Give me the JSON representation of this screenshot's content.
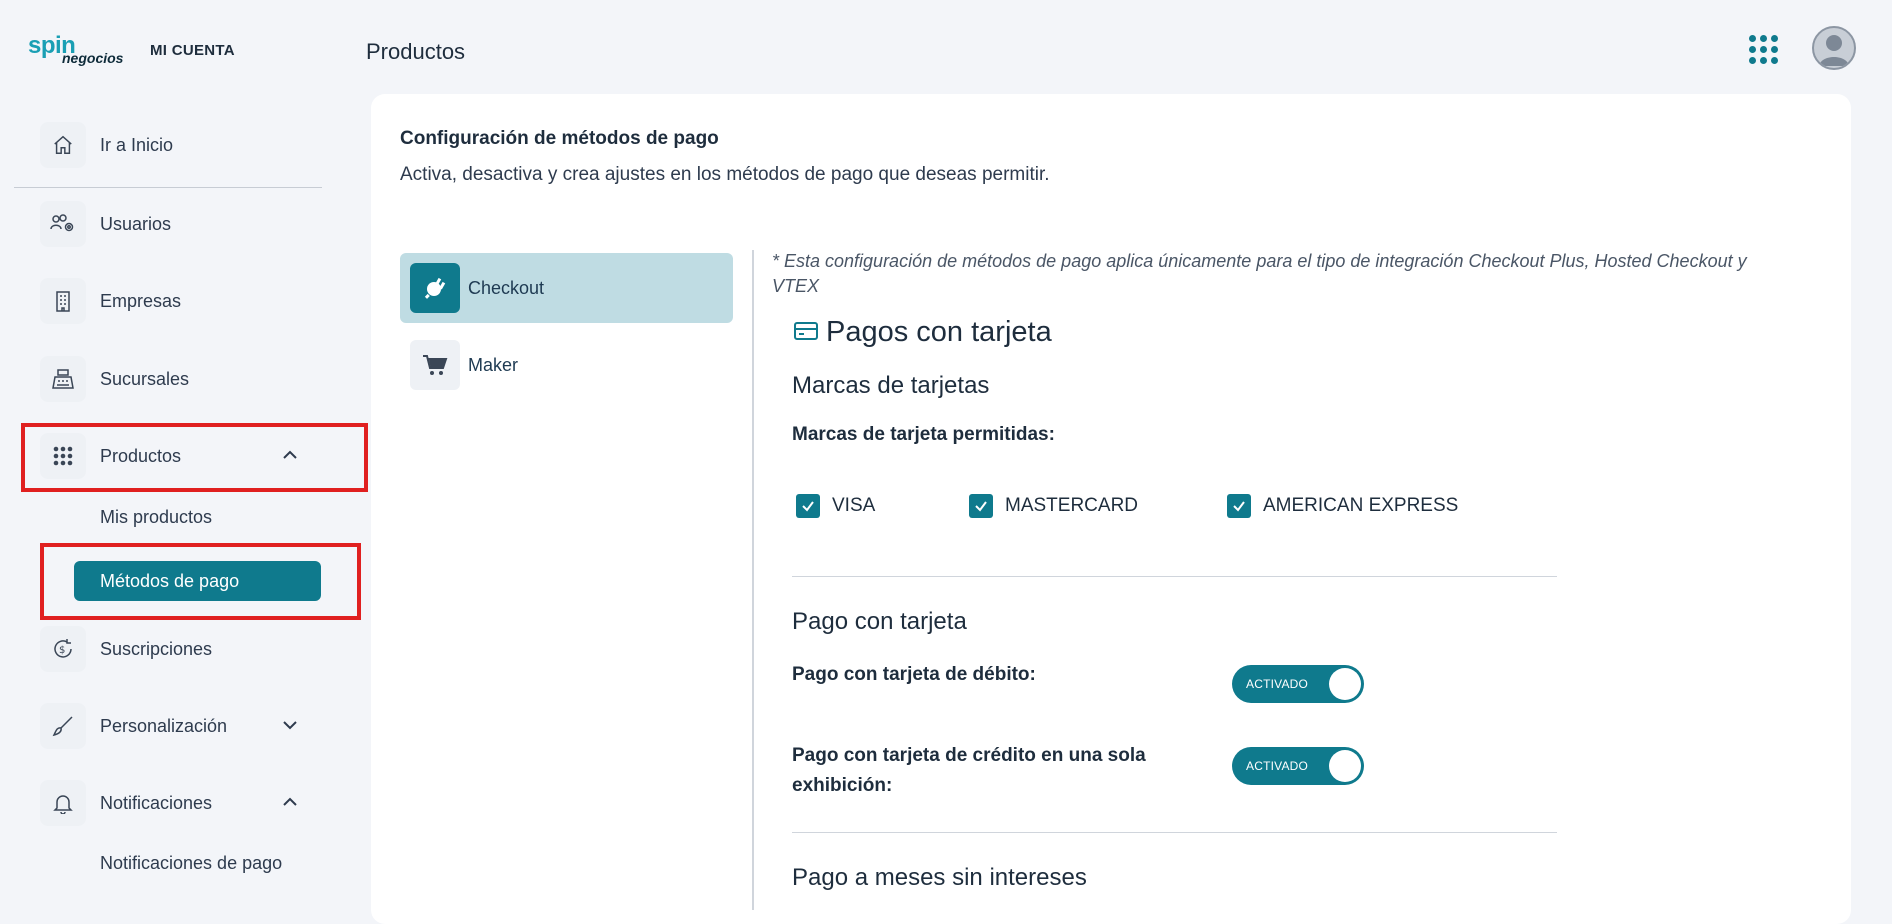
{
  "header": {
    "logo_main": "spin",
    "logo_sub": "negocios",
    "account_label": "MI CUENTA",
    "page_title": "Productos"
  },
  "sidebar": {
    "items": [
      {
        "label": "Ir a Inicio",
        "icon": "home-icon"
      },
      {
        "label": "Usuarios",
        "icon": "users-gear-icon"
      },
      {
        "label": "Empresas",
        "icon": "building-icon"
      },
      {
        "label": "Sucursales",
        "icon": "cash-register-icon"
      },
      {
        "label": "Productos",
        "icon": "grid-icon",
        "expanded": true
      },
      {
        "label": "Suscripciones",
        "icon": "dollar-cycle-icon"
      },
      {
        "label": "Personalización",
        "icon": "brush-icon",
        "expanded": false
      },
      {
        "label": "Notificaciones",
        "icon": "bell-icon",
        "expanded": true
      }
    ],
    "sub_productos": [
      "Mis productos",
      "Métodos de pago"
    ],
    "sub_notificaciones": [
      "Notificaciones de pago"
    ]
  },
  "main": {
    "title": "Configuración de métodos de pago",
    "description": "Activa, desactiva y crea ajustes en los métodos de pago que deseas permitir.",
    "tabs": [
      {
        "label": "Checkout",
        "active": true
      },
      {
        "label": "Maker",
        "active": false
      }
    ],
    "note": "* Esta configuración de métodos de pago aplica únicamente para el tipo de integración Checkout Plus, Hosted Checkout y VTEX",
    "cards_section": {
      "title": "Pagos con tarjeta",
      "brands_title": "Marcas de tarjetas",
      "brands_label": "Marcas de tarjeta permitidas:",
      "brands": [
        {
          "label": "VISA",
          "checked": true
        },
        {
          "label": "MASTERCARD",
          "checked": true
        },
        {
          "label": "AMERICAN EXPRESS",
          "checked": true
        }
      ],
      "payment_title": "Pago con tarjeta",
      "debit_label": "Pago con tarjeta de débito:",
      "credit_label": "Pago con tarjeta de crédito en una sola exhibición:",
      "toggle_on_text": "ACTIVADO",
      "msi_title": "Pago a meses sin intereses"
    }
  },
  "colors": {
    "accent": "#0f7a8d",
    "tab_active_bg": "#bfdce3",
    "highlight": "#e02020"
  }
}
